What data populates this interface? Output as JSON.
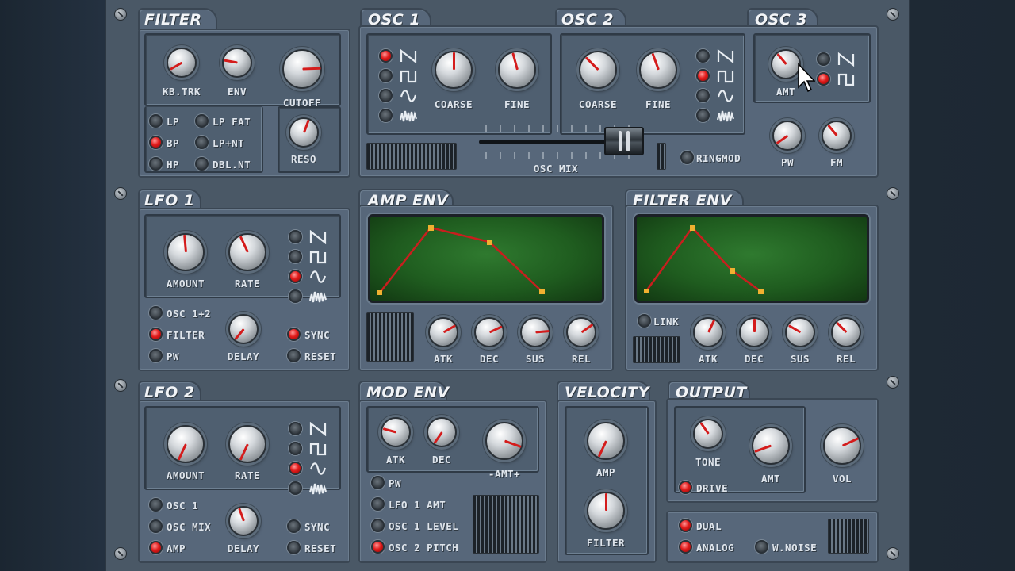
{
  "filter": {
    "title": "FILTER",
    "knobs": {
      "kbtrk": "KB.TRK",
      "env": "ENV",
      "cutoff": "CUTOFF",
      "reso": "RESO"
    },
    "modes": [
      {
        "label": "LP",
        "on": false
      },
      {
        "label": "BP",
        "on": true
      },
      {
        "label": "HP",
        "on": false
      },
      {
        "label": "LP FAT",
        "on": false
      },
      {
        "label": "LP+NT",
        "on": false
      },
      {
        "label": "DBL.NT",
        "on": false
      }
    ]
  },
  "osc1": {
    "title": "OSC 1",
    "coarse": "COARSE",
    "fine": "FINE",
    "wave_selected": "sawtooth"
  },
  "osc2": {
    "title": "OSC 2",
    "coarse": "COARSE",
    "fine": "FINE",
    "wave_selected": "square"
  },
  "osc3": {
    "title": "OSC 3",
    "amt": "AMT",
    "pw": "PW",
    "fm": "FM",
    "wave_selected": "square"
  },
  "osc_mix": {
    "label": "OSC MIX",
    "ringmod": "RINGMOD",
    "ringmod_on": false
  },
  "lfo1": {
    "title": "LFO 1",
    "amount": "AMOUNT",
    "rate": "RATE",
    "delay": "DELAY",
    "wave_selected": "sine",
    "dest": [
      {
        "label": "OSC 1+2",
        "on": false
      },
      {
        "label": "FILTER",
        "on": true
      },
      {
        "label": "PW",
        "on": false
      }
    ],
    "sync": {
      "label": "SYNC",
      "on": true
    },
    "reset": {
      "label": "RESET",
      "on": false
    }
  },
  "amp_env": {
    "title": "AMP ENV",
    "atk": "ATK",
    "dec": "DEC",
    "sus": "SUS",
    "rel": "REL"
  },
  "filter_env": {
    "title": "FILTER ENV",
    "link": "LINK",
    "atk": "ATK",
    "dec": "DEC",
    "sus": "SUS",
    "rel": "REL"
  },
  "lfo2": {
    "title": "LFO 2",
    "amount": "AMOUNT",
    "rate": "RATE",
    "delay": "DELAY",
    "wave_selected": "sine",
    "dest": [
      {
        "label": "OSC 1",
        "on": false
      },
      {
        "label": "OSC MIX",
        "on": false
      },
      {
        "label": "AMP",
        "on": true
      }
    ],
    "sync": {
      "label": "SYNC",
      "on": false
    },
    "reset": {
      "label": "RESET",
      "on": false
    }
  },
  "mod_env": {
    "title": "MOD ENV",
    "atk": "ATK",
    "dec": "DEC",
    "amt": "-AMT+",
    "dest": [
      {
        "label": "PW",
        "on": false
      },
      {
        "label": "LFO 1 AMT",
        "on": false
      },
      {
        "label": "OSC 1 LEVEL",
        "on": false
      },
      {
        "label": "OSC 2 PITCH",
        "on": true
      }
    ]
  },
  "velocity": {
    "title": "VELOCITY",
    "amp": "AMP",
    "filter": "FILTER"
  },
  "output": {
    "title": "OUTPUT",
    "tone": "TONE",
    "amt": "AMT",
    "vol": "VOL",
    "drive": {
      "label": "DRIVE",
      "on": true
    },
    "dual": {
      "label": "DUAL",
      "on": true
    },
    "analog": {
      "label": "ANALOG",
      "on": true
    },
    "wnoise": {
      "label": "W.NOISE",
      "on": false
    }
  },
  "colors": {
    "panel": "#57677a",
    "led_on": "#e21b1b",
    "screen": "#1f5c1f",
    "pointer": "#d41c1c"
  }
}
